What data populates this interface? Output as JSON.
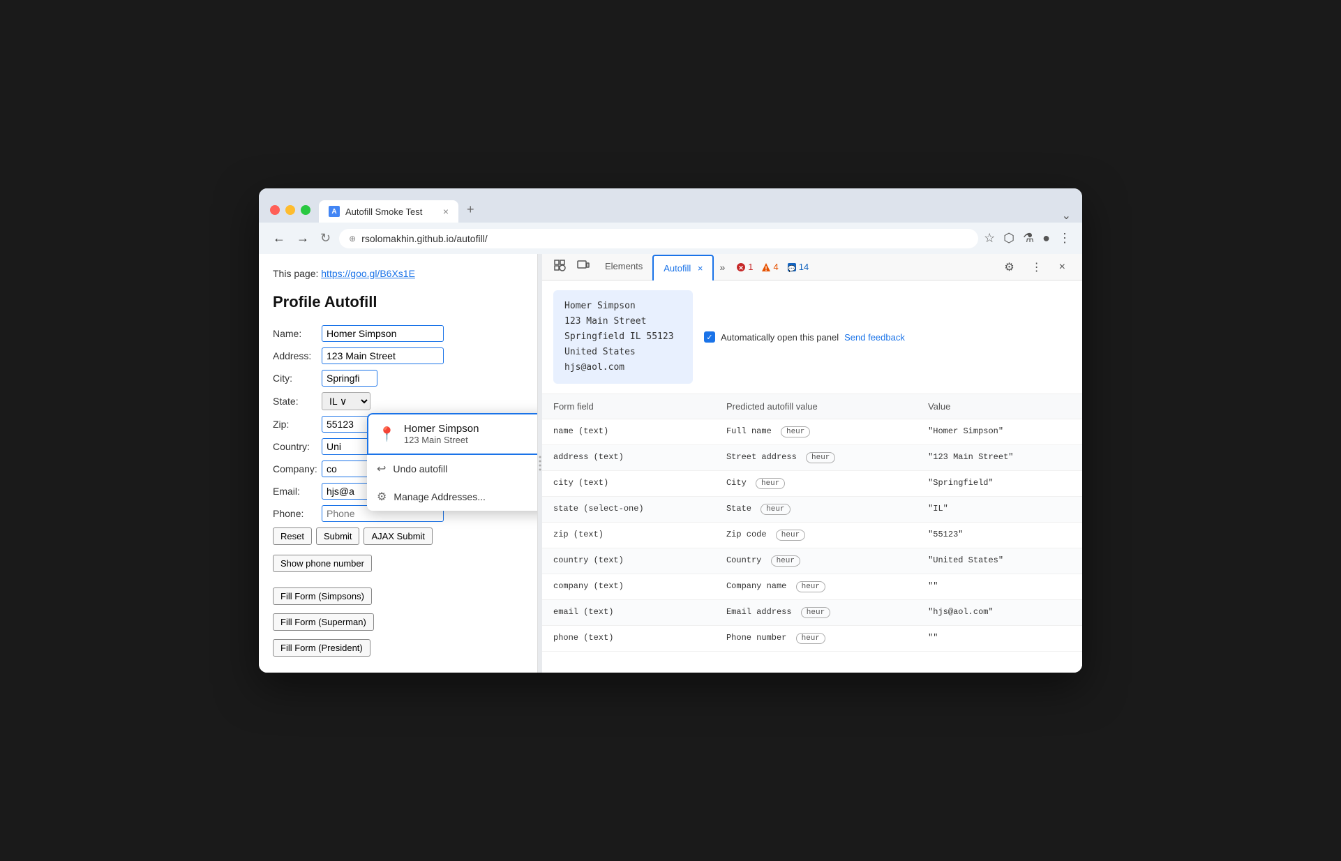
{
  "browser": {
    "tab_title": "Autofill Smoke Test",
    "tab_close": "×",
    "tab_new": "+",
    "tab_chevron": "⌄",
    "address_url": "rsolomakhin.github.io/autofill/",
    "nav": {
      "back": "←",
      "forward": "→",
      "refresh": "↻",
      "security_icon": "⊕"
    },
    "toolbar_icons": {
      "bookmark": "☆",
      "extension": "⬡",
      "lab": "⚗",
      "profile": "●",
      "menu": "⋮"
    }
  },
  "webpage": {
    "page_link_label": "This page:",
    "page_link_url": "https://goo.gl/B6Xs1E",
    "page_title": "Profile Autofill",
    "form": {
      "name_label": "Name:",
      "name_value": "Homer Simpson",
      "address_label": "Address:",
      "address_value": "123 Main Street",
      "city_label": "City:",
      "city_value": "Springfi",
      "state_label": "State:",
      "state_value": "IL",
      "zip_label": "Zip:",
      "zip_value": "55123",
      "country_label": "Country:",
      "country_value": "Uni",
      "company_label": "Company:",
      "company_value": "co",
      "email_label": "Email:",
      "email_value": "hjs@a",
      "phone_label": "Phone:",
      "phone_placeholder": "Phone",
      "buttons": {
        "reset": "Reset",
        "submit": "Submit",
        "ajax_submit": "AJAX Submit",
        "show_phone": "Show phone number",
        "fill_simpsons": "Fill Form (Simpsons)",
        "fill_superman": "Fill Form (Superman)",
        "fill_president": "Fill Form (President)"
      }
    }
  },
  "autofill_dropdown": {
    "item_name": "Homer Simpson",
    "item_address": "123 Main Street",
    "undo_label": "Undo autofill",
    "manage_label": "Manage Addresses..."
  },
  "devtools": {
    "tabs": {
      "elements": "Elements",
      "autofill": "Autofill",
      "close_autofill": "×",
      "more": "»"
    },
    "badges": {
      "error_icon": "✕",
      "error_count": "1",
      "warn_icon": "⚠",
      "warn_count": "4",
      "info_icon": "💬",
      "info_count": "14"
    },
    "icons": {
      "inspect": "⊡",
      "responsive": "◫",
      "gear": "⚙",
      "more": "⋮",
      "close": "×"
    },
    "autofill_panel": {
      "address_card": {
        "line1": "Homer Simpson",
        "line2": "123 Main Street",
        "line3": "Springfield IL 55123",
        "line4": "United States",
        "line5": "hjs@aol.com"
      },
      "checkbox_label": "Automatically open this panel",
      "feedback_label": "Send feedback",
      "table": {
        "headers": [
          "Form field",
          "Predicted autofill value",
          "Value"
        ],
        "rows": [
          {
            "field": "name (text)",
            "predicted": "Full name",
            "heur": "heur",
            "value": "\"Homer Simpson\""
          },
          {
            "field": "address (text)",
            "predicted": "Street address",
            "heur": "heur",
            "value": "\"123 Main Street\""
          },
          {
            "field": "city (text)",
            "predicted": "City",
            "heur": "heur",
            "value": "\"Springfield\""
          },
          {
            "field": "state (select-one)",
            "predicted": "State",
            "heur": "heur",
            "value": "\"IL\""
          },
          {
            "field": "zip (text)",
            "predicted": "Zip code",
            "heur": "heur",
            "value": "\"55123\""
          },
          {
            "field": "country (text)",
            "predicted": "Country",
            "heur": "heur",
            "value": "\"United States\""
          },
          {
            "field": "company (text)",
            "predicted": "Company name",
            "heur": "heur",
            "value": "\"\""
          },
          {
            "field": "email (text)",
            "predicted": "Email address",
            "heur": "heur",
            "value": "\"hjs@aol.com\""
          },
          {
            "field": "phone (text)",
            "predicted": "Phone number",
            "heur": "heur",
            "value": "\"\""
          }
        ]
      }
    }
  }
}
